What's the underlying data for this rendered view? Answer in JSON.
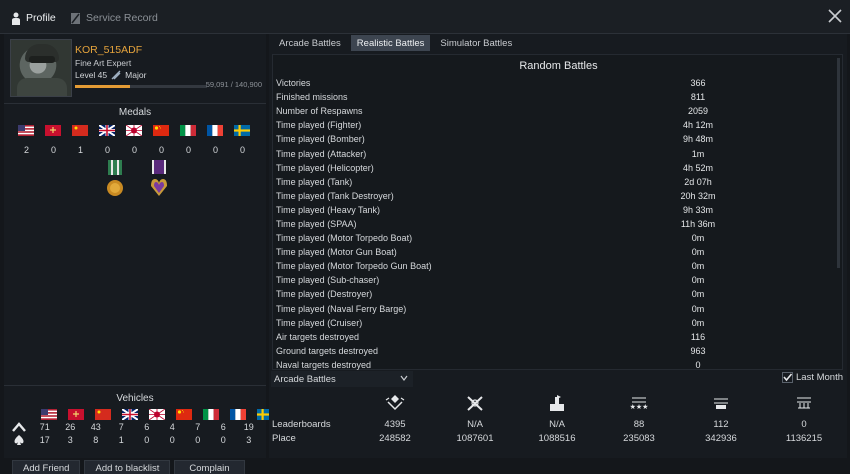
{
  "topbar": {
    "tabs": [
      {
        "label": "Profile",
        "active": true
      },
      {
        "label": "Service Record",
        "active": false
      }
    ]
  },
  "profile": {
    "nickname": "KOR_515ADF",
    "title": "Fine Art Expert",
    "level": "Level 45",
    "rank": "Major",
    "xp": "59,091 / 140,900",
    "xp_progress": 0.42
  },
  "medals": {
    "title": "Medals",
    "nations": [
      "usa",
      "ussr",
      "china",
      "uk",
      "japan",
      "china-alt",
      "italy",
      "france",
      "sweden"
    ],
    "counts": [
      "2",
      "0",
      "1",
      "0",
      "0",
      "0",
      "0",
      "0",
      "0"
    ]
  },
  "vehicles": {
    "title": "Vehicles",
    "nations": [
      "usa",
      "ussr",
      "china",
      "uk",
      "japan",
      "china-alt",
      "italy",
      "france",
      "sweden"
    ],
    "row1": [
      "71",
      "26",
      "43",
      "7",
      "6",
      "4",
      "7",
      "6",
      "19"
    ],
    "row2": [
      "17",
      "3",
      "8",
      "1",
      "0",
      "0",
      "0",
      "0",
      "3"
    ]
  },
  "buttons": {
    "add_friend": "Add Friend",
    "add_blacklist": "Add to blacklist",
    "complain": "Complain"
  },
  "mode_tabs": [
    {
      "label": "Arcade Battles",
      "active": false
    },
    {
      "label": "Realistic Battles",
      "active": true
    },
    {
      "label": "Simulator Battles",
      "active": false
    }
  ],
  "stats": {
    "title": "Random Battles",
    "rows": [
      {
        "label": "Victories",
        "value": "366"
      },
      {
        "label": "Finished missions",
        "value": "811"
      },
      {
        "label": "Number of Respawns",
        "value": "2059"
      },
      {
        "label": "Time played (Fighter)",
        "value": "4h 12m"
      },
      {
        "label": "Time played (Bomber)",
        "value": "9h 48m"
      },
      {
        "label": "Time played (Attacker)",
        "value": "1m"
      },
      {
        "label": "Time played (Helicopter)",
        "value": "4h 52m"
      },
      {
        "label": "Time played (Tank)",
        "value": "2d 07h"
      },
      {
        "label": "Time played (Tank Destroyer)",
        "value": "20h 32m"
      },
      {
        "label": "Time played (Heavy Tank)",
        "value": "9h 33m"
      },
      {
        "label": "Time played (SPAA)",
        "value": "11h 36m"
      },
      {
        "label": "Time played (Motor Torpedo Boat)",
        "value": "0m"
      },
      {
        "label": "Time played (Motor Gun Boat)",
        "value": "0m"
      },
      {
        "label": "Time played (Motor Torpedo Gun Boat)",
        "value": "0m"
      },
      {
        "label": "Time played (Sub-chaser)",
        "value": "0m"
      },
      {
        "label": "Time played (Destroyer)",
        "value": "0m"
      },
      {
        "label": "Time played (Naval Ferry Barge)",
        "value": "0m"
      },
      {
        "label": "Time played (Cruiser)",
        "value": "0m"
      },
      {
        "label": "Air targets destroyed",
        "value": "116"
      },
      {
        "label": "Ground targets destroyed",
        "value": "963"
      },
      {
        "label": "Naval targets destroyed",
        "value": "0"
      }
    ]
  },
  "leaderboard_select": "Arcade Battles",
  "last_month": "Last Month",
  "last_month_checked": true,
  "leaderboards": {
    "label": "Leaderboards",
    "place_label": "Place",
    "icons": [
      "skill-icon",
      "kills-icon",
      "victories-icon",
      "air-kills-icon",
      "ground-kills-icon",
      "naval-kills-icon"
    ],
    "values": [
      "4395",
      "N/A",
      "N/A",
      "88",
      "112",
      "0"
    ],
    "places": [
      "248582",
      "1087601",
      "1088516",
      "235083",
      "342936",
      "1136215"
    ]
  }
}
